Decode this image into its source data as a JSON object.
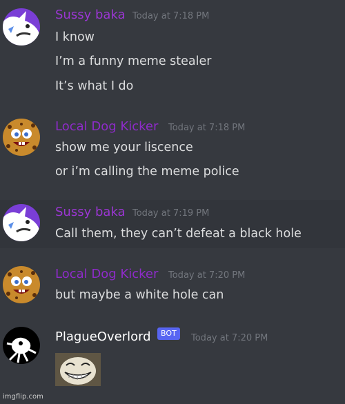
{
  "colors": {
    "background": "#36393f",
    "hover_background": "#32353b",
    "sussy_name": "#9b36d3",
    "dog_name": "#8e2bc9",
    "bot_name": "#ffffff",
    "timestamp": "#72767d",
    "text": "#dcddde",
    "bot_badge": "#5865f2"
  },
  "messages": [
    {
      "username": "Sussy baka",
      "timestamp": "Today at 7:18 PM",
      "avatar_icon": "purple-white-wolf-avatar",
      "lines": [
        "I know",
        "I’m a funny meme stealer",
        "It’s what I do"
      ]
    },
    {
      "username": "Local Dog Kicker",
      "timestamp": "Today at 7:18 PM",
      "avatar_icon": "spotted-cookie-face-avatar",
      "lines": [
        "show me your liscence",
        "or i’m calling the meme police"
      ]
    },
    {
      "username": "Sussy baka",
      "timestamp": "Today at 7:19 PM",
      "avatar_icon": "purple-white-wolf-avatar",
      "lines": [
        "Call them, they can’t defeat a black hole"
      ]
    },
    {
      "username": "Local Dog Kicker",
      "timestamp": "Today at 7:20 PM",
      "avatar_icon": "spotted-cookie-face-avatar",
      "lines": [
        "but maybe a white hole can"
      ]
    },
    {
      "username": "PlagueOverlord",
      "badge": "BOT",
      "timestamp": "Today at 7:20 PM",
      "avatar_icon": "white-splat-black-avatar",
      "attachment_icon": "troll-face-image"
    }
  ],
  "watermark": "imgflip.com"
}
